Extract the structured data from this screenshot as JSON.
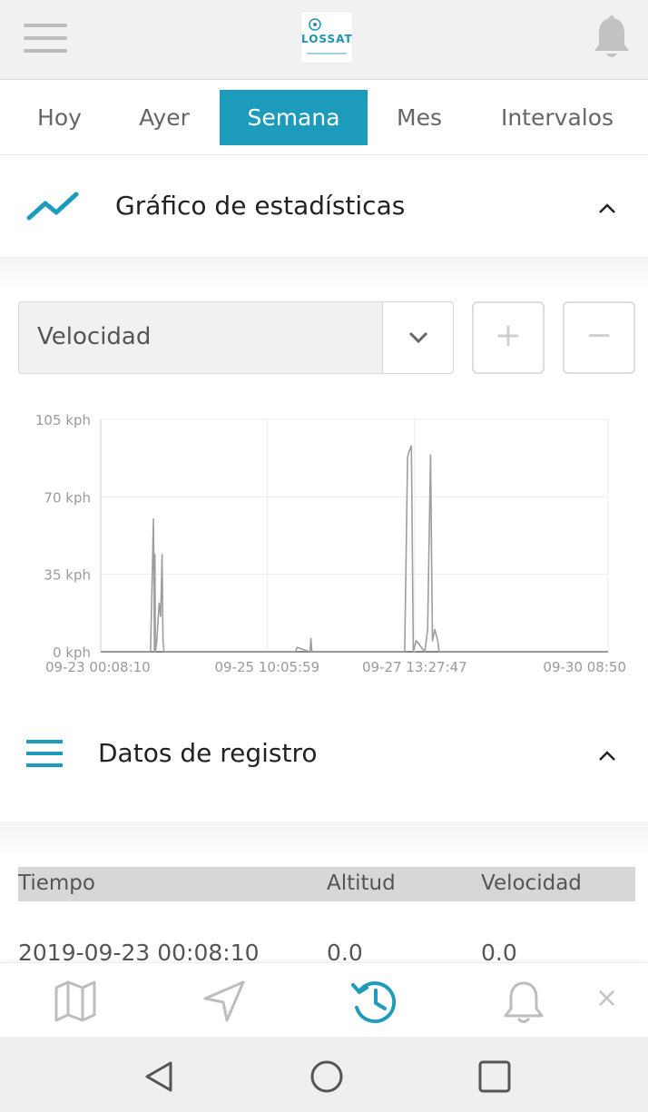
{
  "header": {
    "logo_text": "LOSSAT",
    "menu_icon": "hamburger-icon",
    "bell_icon": "bell-icon"
  },
  "tabs": [
    {
      "label": "Hoy",
      "active": false
    },
    {
      "label": "Ayer",
      "active": false
    },
    {
      "label": "Semana",
      "active": true
    },
    {
      "label": "Mes",
      "active": false
    },
    {
      "label": "Intervalos",
      "active": false
    }
  ],
  "stats_section": {
    "title": "Gráfico de estadísticas",
    "icon": "line-chart-icon"
  },
  "controls": {
    "selected_metric": "Velocidad",
    "zoom_in_label": "+",
    "zoom_out_label": "−"
  },
  "chart_data": {
    "type": "line",
    "series": [
      {
        "values": [
          [
            "09-23 00:08:10",
            0
          ],
          [
            "09-23 17:30",
            0
          ],
          [
            "09-23 18:30",
            60
          ],
          [
            "09-23 18:50",
            0
          ],
          [
            "09-23 19:00",
            44
          ],
          [
            "09-23 19:10",
            0
          ],
          [
            "09-23 19:40",
            5
          ],
          [
            "09-23 20:05",
            14
          ],
          [
            "09-23 20:30",
            22
          ],
          [
            "09-23 21:00",
            16
          ],
          [
            "09-23 21:30",
            44
          ],
          [
            "09-23 21:50",
            5
          ],
          [
            "09-23 22:10",
            0
          ],
          [
            "09-25 20:00",
            0
          ],
          [
            "09-25 20:30",
            2
          ],
          [
            "09-26 01:00",
            0
          ],
          [
            "09-26 01:20",
            6
          ],
          [
            "09-26 01:40",
            0
          ],
          [
            "09-27 10:00",
            0
          ],
          [
            "09-27 11:00",
            88
          ],
          [
            "09-27 11:40",
            91
          ],
          [
            "09-27 12:20",
            93
          ],
          [
            "09-27 13:00",
            0
          ],
          [
            "09-27 14:00",
            5
          ],
          [
            "09-27 17:00",
            0
          ],
          [
            "09-27 18:00",
            10
          ],
          [
            "09-27 19:00",
            89
          ],
          [
            "09-27 19:40",
            5
          ],
          [
            "09-27 20:30",
            10
          ],
          [
            "09-27 21:30",
            5
          ],
          [
            "09-27 22:00",
            0
          ],
          [
            "09-30 08:50",
            0
          ]
        ]
      }
    ],
    "x_ticks": [
      "09-23 00:08:10",
      "09-25 10:05:59",
      "09-27 13:27:47",
      "09-30 08:50"
    ],
    "y_ticks": [
      "0 kph",
      "35 kph",
      "70 kph",
      "105 kph"
    ],
    "ylim": [
      0,
      105
    ],
    "grid": true,
    "line_color": "#9e9e9e"
  },
  "records_section": {
    "title": "Datos de registro",
    "icon": "list-icon"
  },
  "table": {
    "columns": [
      "Tiempo",
      "Altitud",
      "Velocidad"
    ],
    "rows": [
      [
        "2019-09-23 00:08:10",
        "0.0",
        "0.0"
      ]
    ]
  },
  "bottom_nav": {
    "items": [
      "map-icon",
      "navigation-icon",
      "history-icon",
      "bell-icon"
    ],
    "active": "history-icon",
    "close_label": "×"
  },
  "colors": {
    "accent": "#1d9bbd",
    "muted_icon": "#bdbdbd"
  }
}
